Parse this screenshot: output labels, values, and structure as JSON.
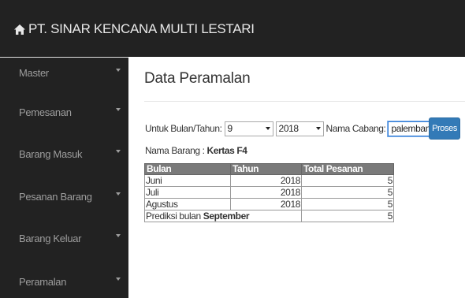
{
  "header": {
    "brand": "PT. SINAR KENCANA MULTI LESTARI",
    "brand_icon": "home-icon"
  },
  "sidebar": {
    "items": [
      {
        "label": "Master"
      },
      {
        "label": "Pemesanan"
      },
      {
        "label": "Barang Masuk"
      },
      {
        "label": "Pesanan Barang"
      },
      {
        "label": "Barang Keluar"
      },
      {
        "label": "Peramalan"
      }
    ]
  },
  "main": {
    "title": "Data Peramalan",
    "filter": {
      "bulan_tahun_label": "Untuk Bulan/Tahun:",
      "bulan_value": "9",
      "tahun_value": "2018",
      "cabang_label": "Nama Cabang:",
      "cabang_value": "palembang",
      "submit_label": "Proses"
    },
    "nama_barang_label": "Nama Barang :",
    "nama_barang_value": "Kertas F4",
    "table": {
      "headers": [
        "Bulan",
        "Tahun",
        "Total Pesanan"
      ],
      "rows": [
        {
          "bulan": "Juni",
          "tahun": "2018",
          "total": "5"
        },
        {
          "bulan": "Juli",
          "tahun": "2018",
          "total": "5"
        },
        {
          "bulan": "Agustus",
          "tahun": "2018",
          "total": "5"
        }
      ],
      "prediksi_label": "Prediksi bulan",
      "prediksi_bulan": "September",
      "prediksi_total": "5"
    }
  },
  "colors": {
    "topbar": "#222222",
    "sidebar": "#222222",
    "button": "#337ab7",
    "table_header": "#7a7a7a"
  }
}
